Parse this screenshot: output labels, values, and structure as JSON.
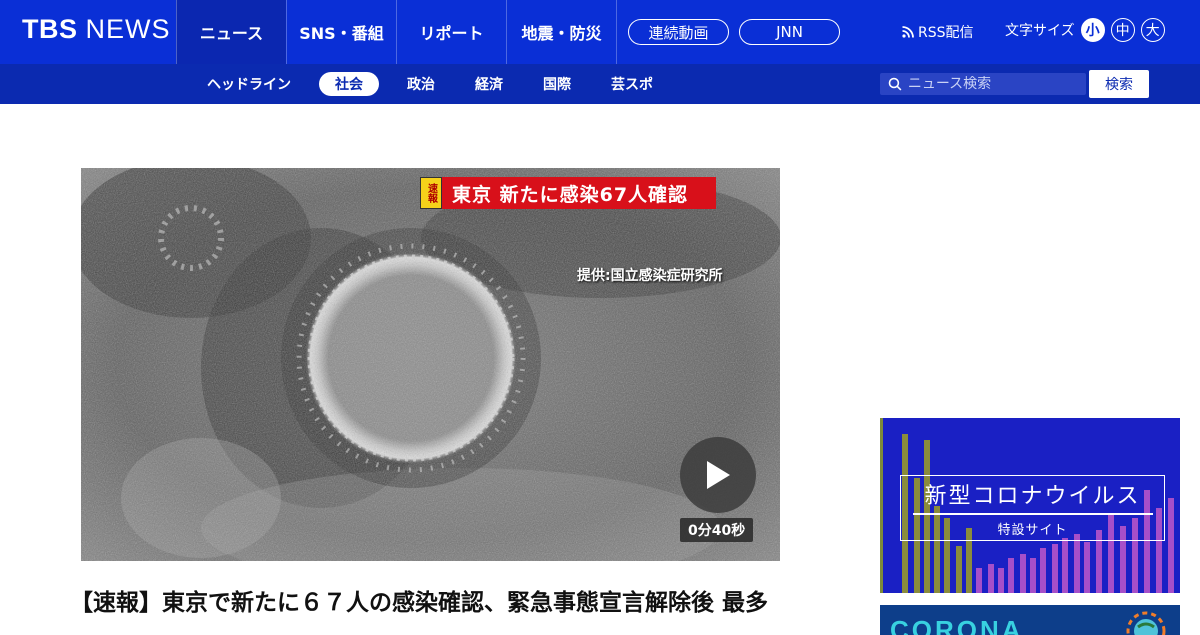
{
  "brand": {
    "logo_bold": "TBS",
    "logo_rest": "NEWS"
  },
  "main_nav": [
    {
      "label": "ニュース",
      "active": true
    },
    {
      "label": "SNS・番組",
      "active": false
    },
    {
      "label": "リポート",
      "active": false
    },
    {
      "label": "地震・防災",
      "active": false
    }
  ],
  "pills": {
    "video": "連続動画",
    "jnn": "JNN"
  },
  "rss_label": "RSS配信",
  "font_size": {
    "label": "文字サイズ",
    "small": "小",
    "medium": "中",
    "large": "大",
    "selected": "小"
  },
  "sub_nav": [
    {
      "label": "ヘッドライン",
      "active": false
    },
    {
      "label": "社会",
      "active": true
    },
    {
      "label": "政治",
      "active": false
    },
    {
      "label": "経済",
      "active": false
    },
    {
      "label": "国際",
      "active": false
    },
    {
      "label": "芸スポ",
      "active": false
    }
  ],
  "search": {
    "placeholder": "ニュース検索",
    "button": "検索"
  },
  "hero": {
    "caption_tag": "速報",
    "caption_text": "東京 新たに感染67人確認",
    "credit": "提供:国立感染症研究所",
    "duration": "0分40秒"
  },
  "headline": "【速報】東京で新たに６７人の感染確認、緊急事態宣言解除後 最多",
  "sidebar": {
    "banner_covid": {
      "title": "新型コロナウイルス",
      "subtitle": "特設サイト"
    },
    "banner_corona": {
      "text": "CORONA"
    }
  },
  "colors": {
    "brand_blue": "#0a2fd6",
    "subnav_blue": "#0b2ab0",
    "caption_red": "#d8101a",
    "caption_yellow": "#f6d21a"
  },
  "icons": {
    "rss": "rss-icon",
    "search": "search-icon",
    "play": "play-icon"
  }
}
